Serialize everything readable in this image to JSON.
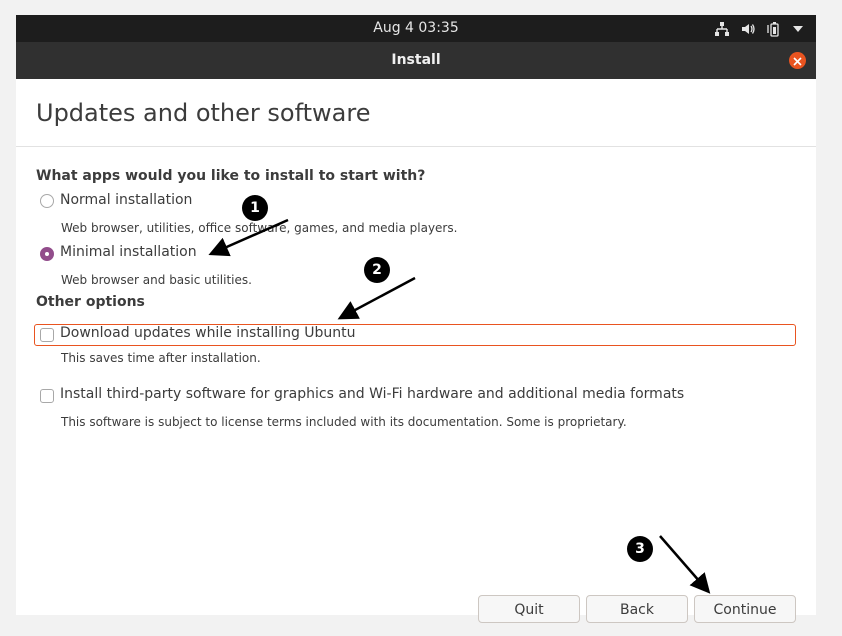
{
  "topbar": {
    "clock": "Aug 4  03:35"
  },
  "window": {
    "title": "Install",
    "heading": "Updates and other software"
  },
  "apps_section": {
    "question": "What apps would you like to install to start with?",
    "options": [
      {
        "label": "Normal installation",
        "description": "Web browser, utilities, office software, games, and media players.",
        "selected": false
      },
      {
        "label": "Minimal installation",
        "description": "Web browser and basic utilities.",
        "selected": true
      }
    ]
  },
  "other_options": {
    "title": "Other options",
    "items": [
      {
        "label": "Download updates while installing Ubuntu",
        "description": "This saves time after installation.",
        "checked": false
      },
      {
        "label": "Install third-party software for graphics and Wi-Fi hardware and additional media formats",
        "description": "This software is subject to license terms included with its documentation. Some is proprietary.",
        "checked": false
      }
    ]
  },
  "buttons": {
    "quit": "Quit",
    "back": "Back",
    "continue": "Continue"
  },
  "annotations": {
    "step1": "1",
    "step2": "2",
    "step3": "3"
  },
  "icons": [
    "network-icon",
    "volume-icon",
    "battery-icon",
    "system-menu-arrow-icon",
    "close-icon"
  ],
  "colors": {
    "accent": "#e95420",
    "radio_selected": "#924d8b",
    "topbar": "#1d1d1d",
    "titlebar": "#303030"
  }
}
